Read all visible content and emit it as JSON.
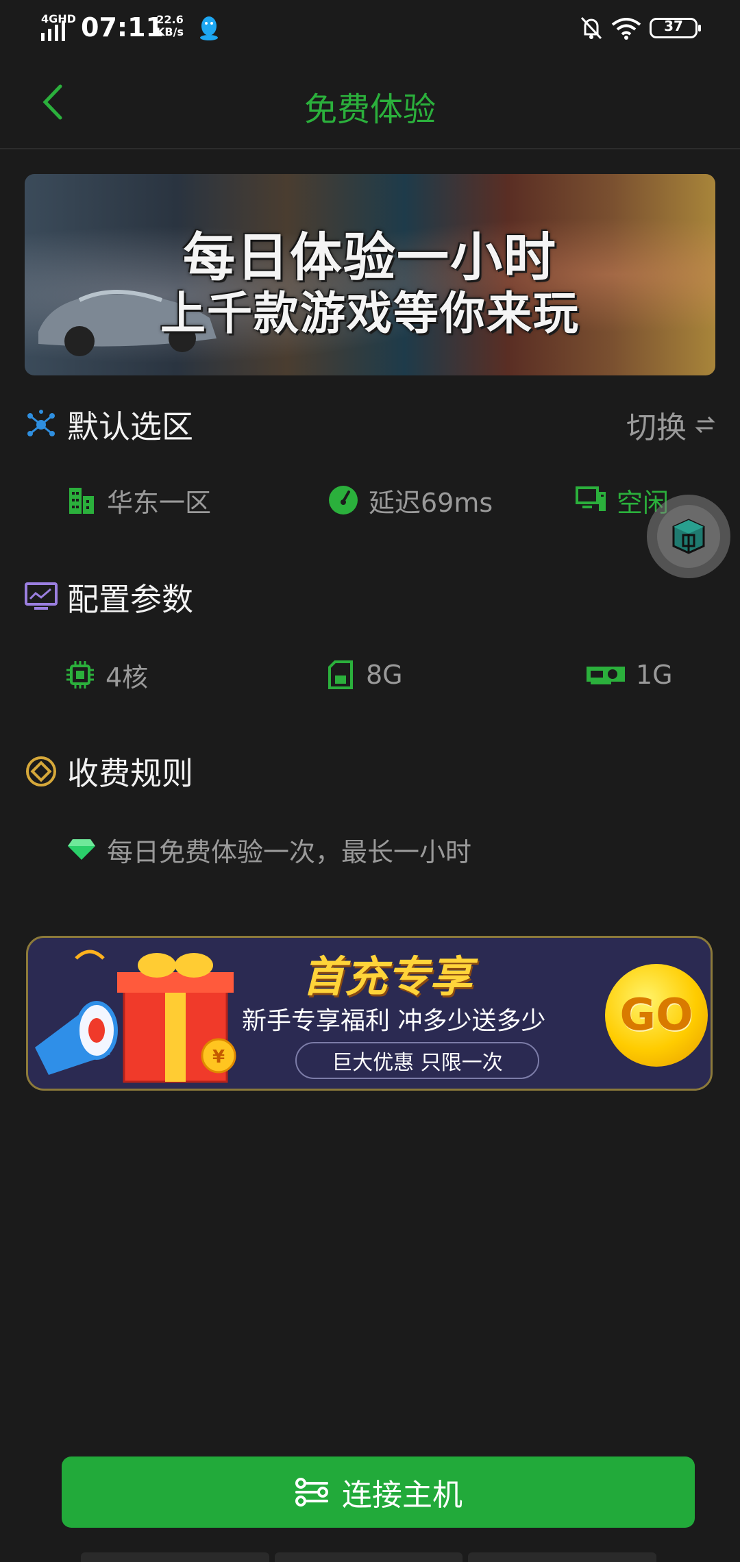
{
  "status_bar": {
    "network": "4GHD",
    "time": "07:11",
    "speed_value": "22.6",
    "speed_unit": "KB/s",
    "battery": "37"
  },
  "header": {
    "title": "免费体验"
  },
  "hero": {
    "line1": "每日体验一小时",
    "line2": "上千款游戏等你来玩"
  },
  "region": {
    "title": "默认选区",
    "switch_label": "切换",
    "zone": "华东一区",
    "latency": "延迟69ms",
    "status": "空闲"
  },
  "config": {
    "title": "配置参数",
    "cpu": "4核",
    "memory": "8G",
    "gpu": "1G"
  },
  "billing": {
    "title": "收费规则",
    "rule": "每日免费体验一次，最长一小时"
  },
  "promo": {
    "title": "首充专享",
    "subtitle": "新手专享福利 冲多少送多少",
    "pill": "巨大优惠 只限一次",
    "go": "GO",
    "coin": "¥"
  },
  "footer": {
    "connect_label": "连接主机"
  },
  "colors": {
    "accent_green": "#2bb03c",
    "button_green": "#22aa3a",
    "background": "#1b1b1b",
    "muted_text": "#9a9a9a"
  }
}
